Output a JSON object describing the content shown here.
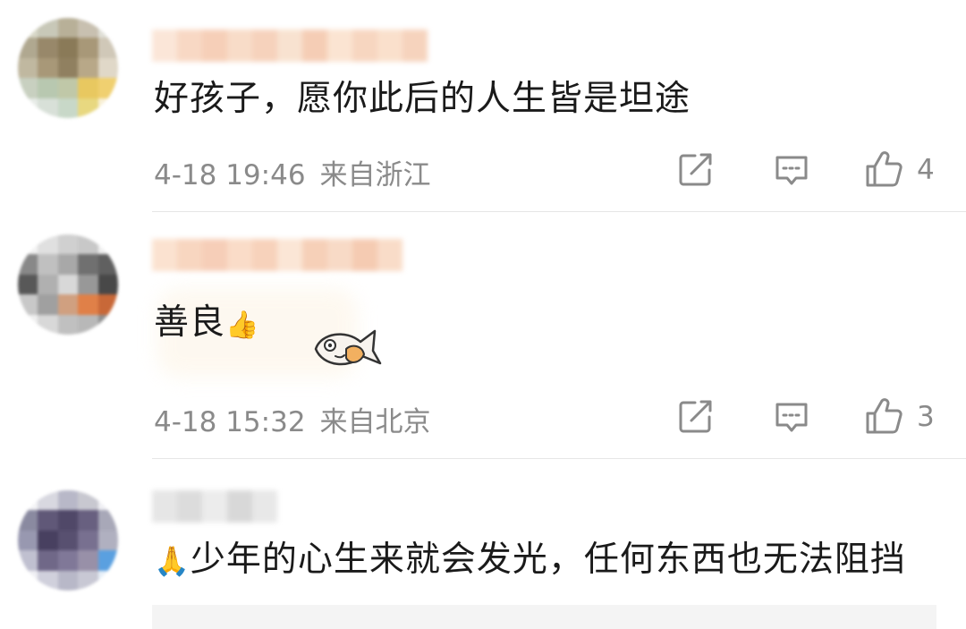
{
  "comments": [
    {
      "text": "好孩子，愿你此后的人生皆是坦途",
      "time": "4-18 19:46",
      "location": "来自浙江",
      "likes": "4",
      "icons": [
        "share-icon",
        "comment-icon",
        "like-icon"
      ]
    },
    {
      "text": "善良",
      "emoji": "👍",
      "time": "4-18 15:32",
      "location": "来自北京",
      "likes": "3",
      "icons": [
        "share-icon",
        "comment-icon",
        "like-icon"
      ]
    },
    {
      "text": "少年的心生来就会发光，任何东西也无法阻挡",
      "emoji": "🙏"
    }
  ],
  "colors": {
    "meta_text": "#8a8a8a",
    "body_text": "#1a1a1a",
    "divider": "#e6e6e6"
  }
}
